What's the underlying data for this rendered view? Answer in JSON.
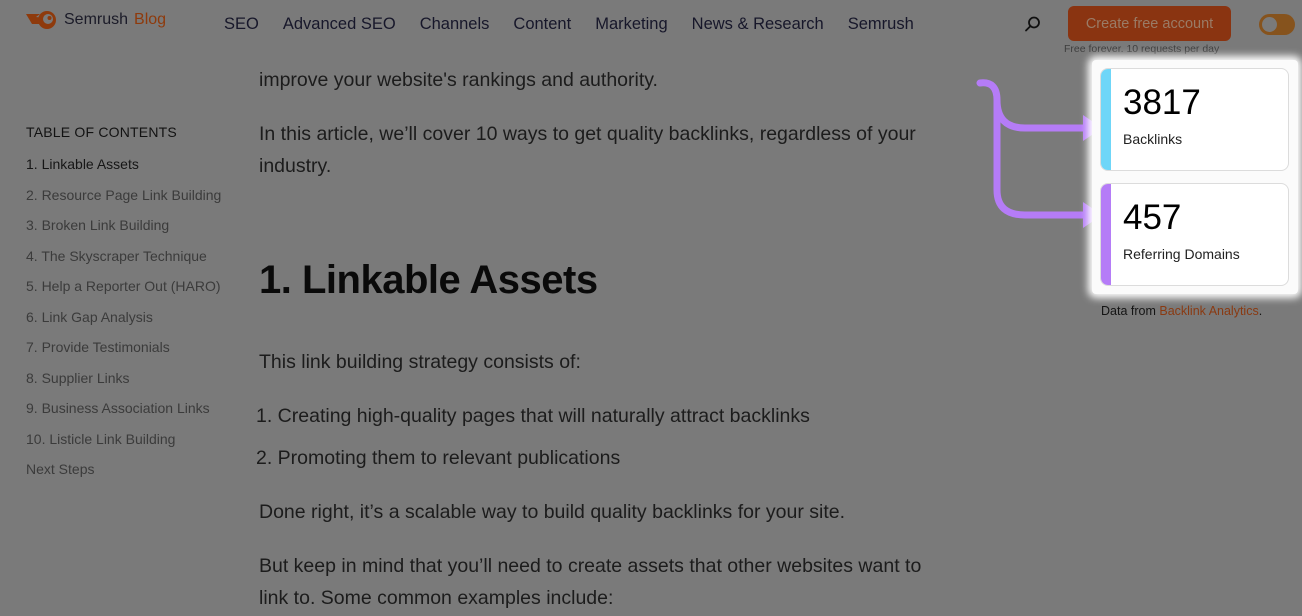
{
  "header": {
    "logo_name": "Semrush",
    "logo_suffix": "Blog",
    "nav": [
      "SEO",
      "Advanced SEO",
      "Channels",
      "Content",
      "Marketing",
      "News & Research",
      "Semrush"
    ],
    "search_icon": "search-icon",
    "cta_label": "Create free account",
    "cta_subtext": "Free forever. 10 requests per day",
    "theme_toggle": "theme-toggle"
  },
  "toc": {
    "title": "TABLE OF CONTENTS",
    "items": [
      "1. Linkable Assets",
      "2. Resource Page Link Building",
      "3. Broken Link Building",
      "4. The Skyscraper Technique",
      "5. Help a Reporter Out (HARO)",
      "6. Link Gap Analysis",
      "7. Provide Testimonials",
      "8. Supplier Links",
      "9. Business Association Links",
      "10. Listicle Link Building",
      "Next Steps"
    ]
  },
  "article": {
    "intro_tail": "improve your website's rankings and authority.",
    "intro_p2": "In this article, we’ll cover 10 ways to get quality backlinks, regardless of your industry.",
    "heading": "1. Linkable Assets",
    "p_strategy": "This link building strategy consists of:",
    "list": [
      "1. Creating high-quality pages that will naturally attract backlinks",
      "2. Promoting them to relevant publications"
    ],
    "p_done": "Done right, it’s a scalable way to build quality backlinks for your site.",
    "p_keep": "But keep in mind that you’ll need to create assets that other websites want to link to. Some common examples include:"
  },
  "stats": {
    "cards": [
      {
        "value": "3817",
        "label": "Backlinks",
        "color": "#6fd6f8"
      },
      {
        "value": "457",
        "label": "Referring Domains",
        "color": "#b57cf7"
      }
    ],
    "source_prefix": "Data from ",
    "source_link": "Backlink Analytics",
    "source_suffix": ".",
    "arrow_color": "#b57cf7"
  }
}
